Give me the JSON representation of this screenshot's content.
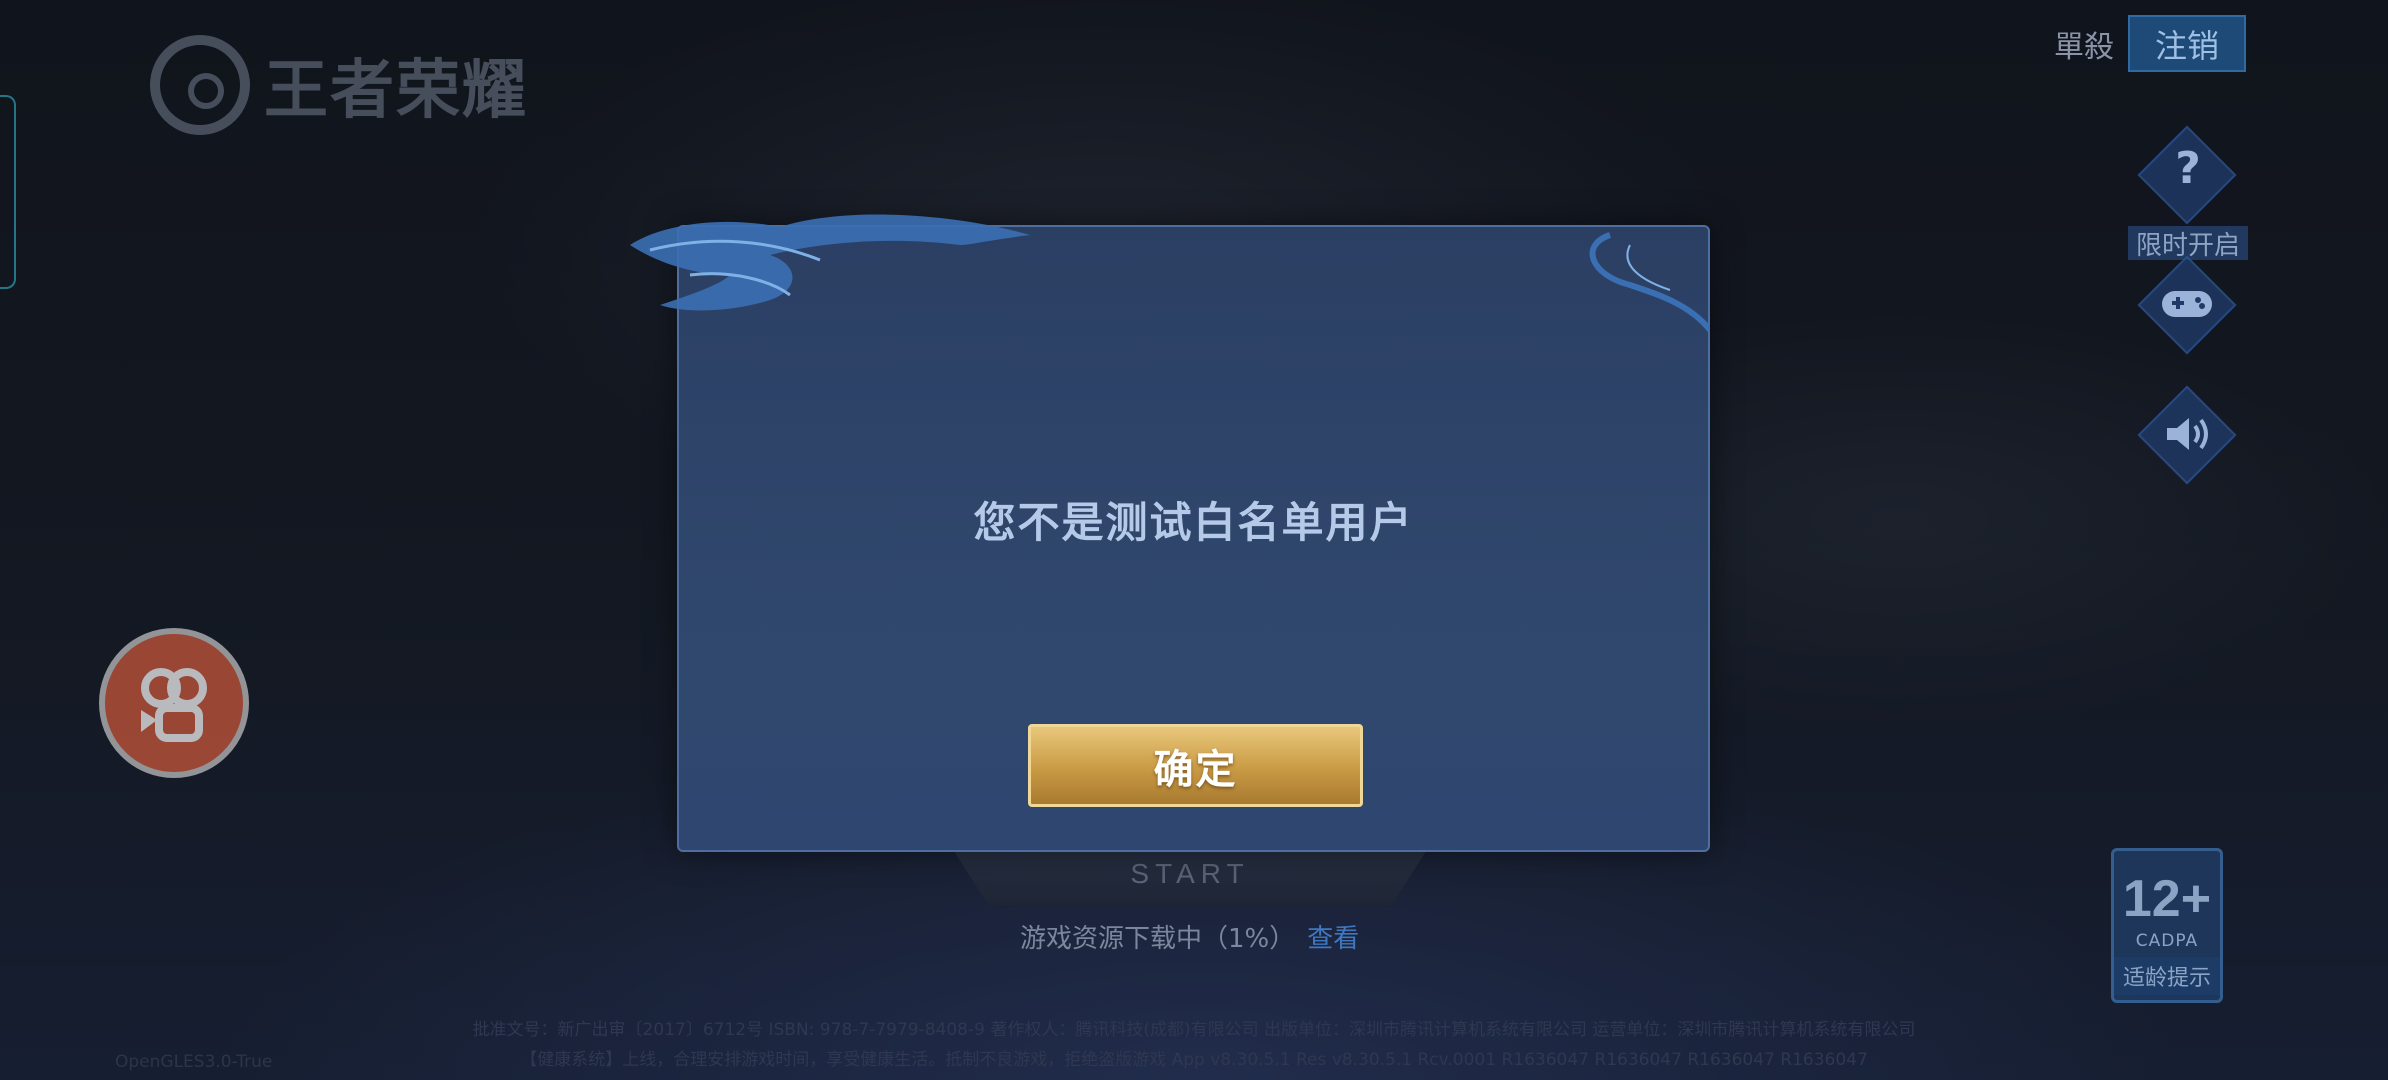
{
  "logo": {
    "text": "王者荣耀"
  },
  "top_right": {
    "solo_label": "單殺",
    "logout_label": "注销"
  },
  "right_icons": {
    "help_icon": "question-icon",
    "limited_label": "限时开启",
    "gamepad_icon": "gamepad-icon",
    "sound_icon": "speaker-icon"
  },
  "left": {
    "record_icon": "video-camera-icon"
  },
  "dialog": {
    "message": "您不是测试白名单用户",
    "confirm_label": "确定"
  },
  "start_button": {
    "label": "START"
  },
  "download": {
    "status": "游戏资源下载中（1%）",
    "link": "查看"
  },
  "age_rating": {
    "age": "12+",
    "org": "CADPA",
    "tip": "适龄提示"
  },
  "footer": {
    "line1": "批准文号：新广出审〔2017〕6712号  ISBN: 978-7-7979-8408-9  著作权人：腾讯科技(成都)有限公司  出版单位：深圳市腾讯计算机系统有限公司  运营单位：深圳市腾讯计算机系统有限公司",
    "line2": "【健康系统】上线，合理安排游戏时间，享受健康生活。抵制不良游戏，拒绝盗版游戏  App v8.30.5.1 Res v8.30.5.1 Rcv.0001 R1636047 R1636047 R1636047 R1636047",
    "build": "OpenGLES3.0-True"
  }
}
